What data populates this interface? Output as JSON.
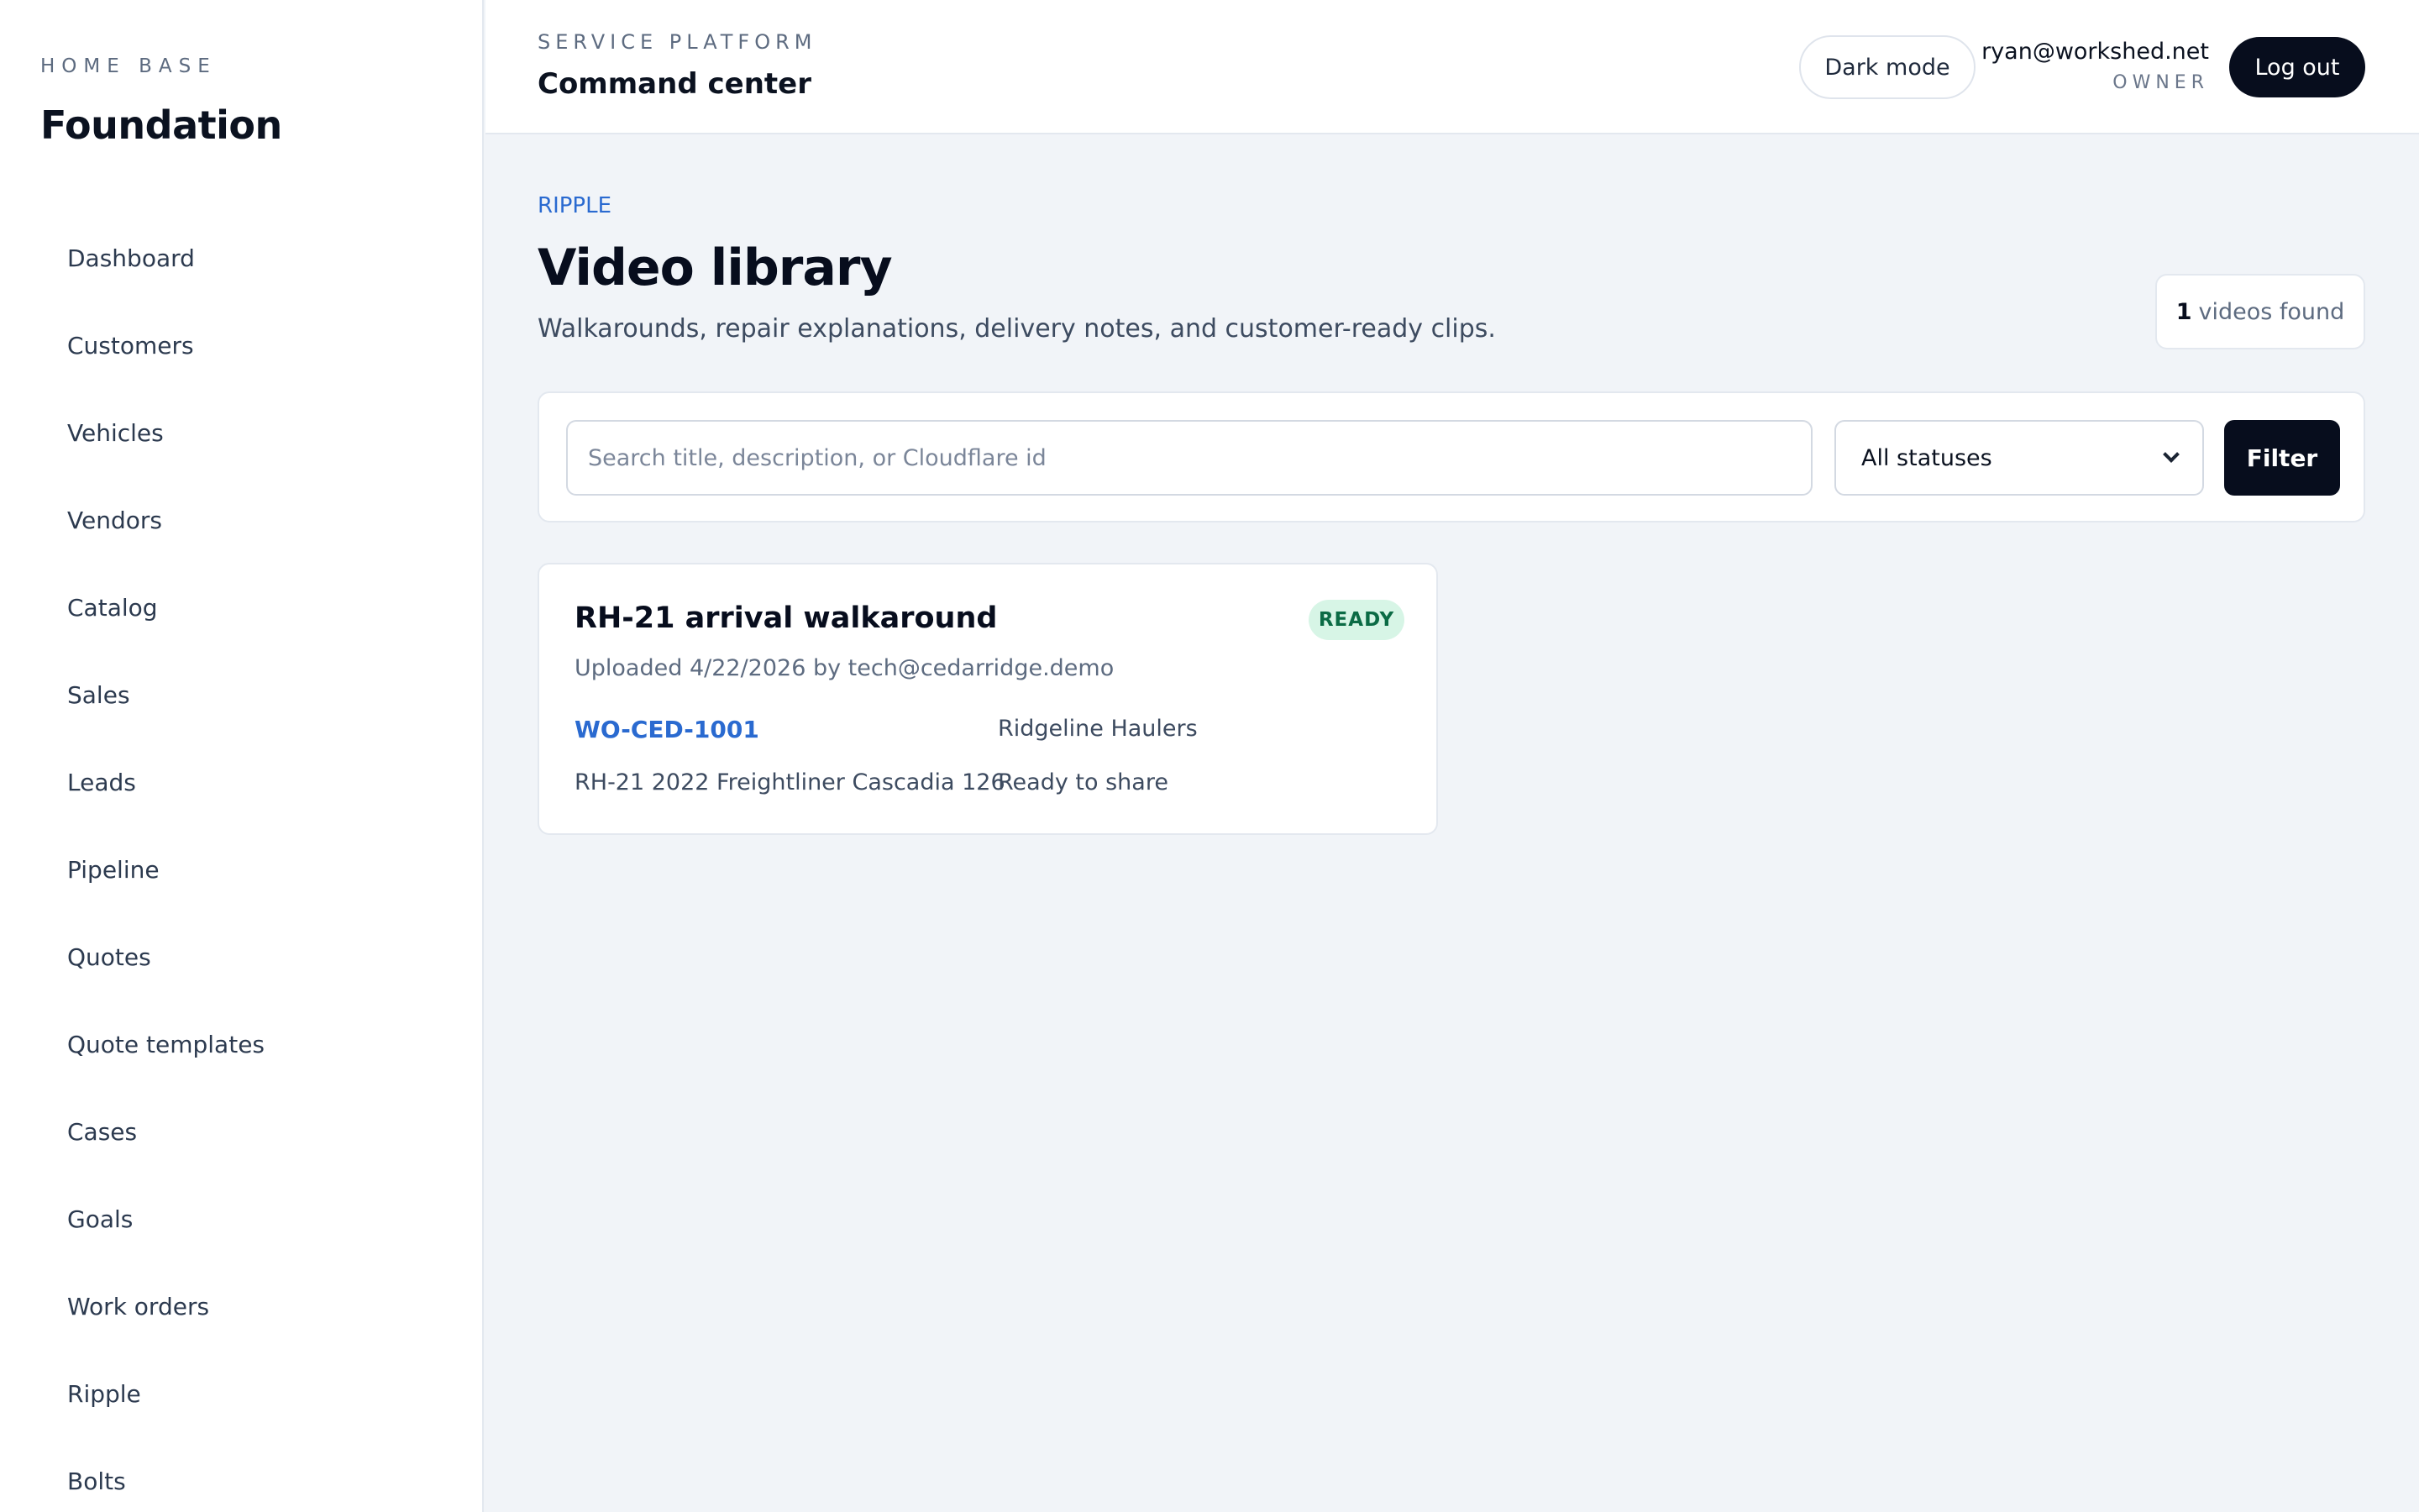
{
  "sidebar": {
    "kicker": "HOME BASE",
    "title": "Foundation",
    "items": [
      {
        "label": "Dashboard"
      },
      {
        "label": "Customers"
      },
      {
        "label": "Vehicles"
      },
      {
        "label": "Vendors"
      },
      {
        "label": "Catalog"
      },
      {
        "label": "Sales"
      },
      {
        "label": "Leads"
      },
      {
        "label": "Pipeline"
      },
      {
        "label": "Quotes"
      },
      {
        "label": "Quote templates"
      },
      {
        "label": "Cases"
      },
      {
        "label": "Goals"
      },
      {
        "label": "Work orders"
      },
      {
        "label": "Ripple"
      },
      {
        "label": "Bolts"
      }
    ]
  },
  "header": {
    "kicker": "SERVICE PLATFORM",
    "title": "Command center",
    "dark_mode_label": "Dark mode",
    "user_email": "ryan@workshed.net",
    "user_role": "OWNER",
    "logout_label": "Log out"
  },
  "page": {
    "eyebrow": "RIPPLE",
    "title": "Video library",
    "subtitle": "Walkarounds, repair explanations, delivery notes, and customer-ready clips.",
    "count_value": "1",
    "count_label": "videos found"
  },
  "filters": {
    "search_placeholder": "Search title, description, or Cloudflare id",
    "search_value": "",
    "status_selected": "All statuses",
    "filter_label": "Filter"
  },
  "videos": [
    {
      "title": "RH-21 arrival walkaround",
      "status": "READY",
      "meta": "Uploaded 4/22/2026 by tech@cedarridge.demo",
      "work_order": "WO-CED-1001",
      "customer": "Ridgeline Haulers",
      "vehicle": "RH-21 2022 Freightliner Cascadia 126",
      "share_status": "Ready to share"
    }
  ],
  "colors": {
    "accent": "#2a6ad0",
    "primary_dark": "#070d1d",
    "ready_badge_bg": "#d7f5e6",
    "ready_badge_text": "#0b6b45",
    "page_bg": "#f1f4f8"
  }
}
